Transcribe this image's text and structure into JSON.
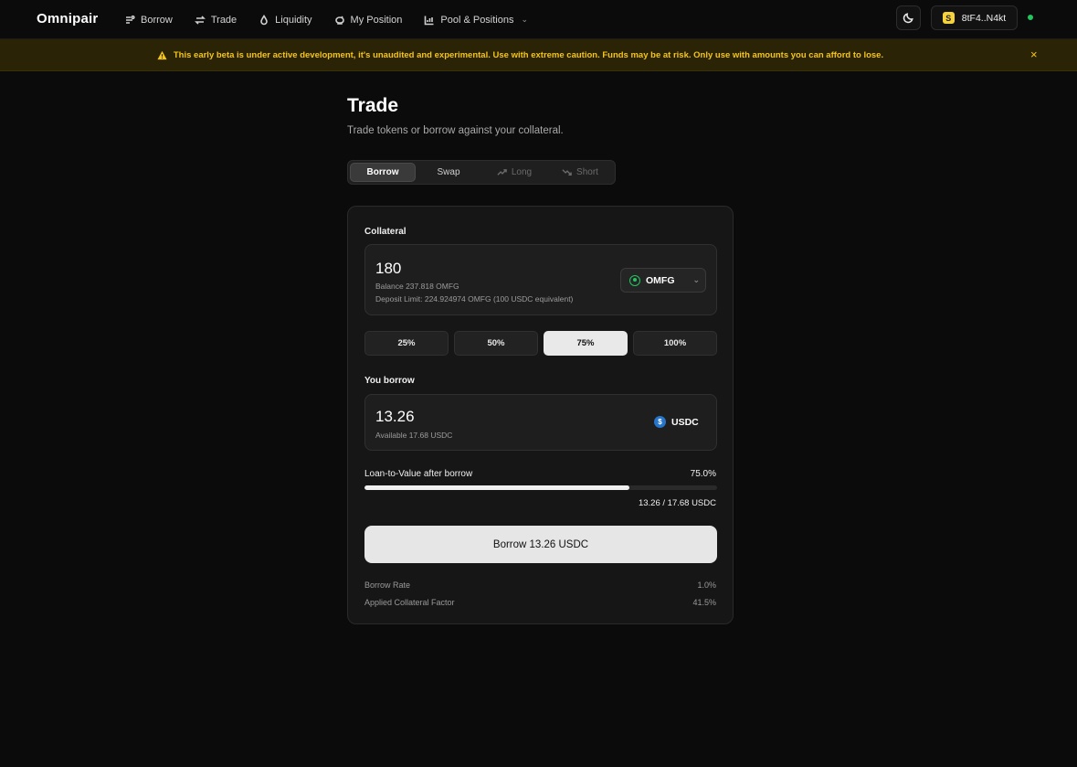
{
  "app": {
    "brand": "Omnipair"
  },
  "nav": {
    "items": [
      {
        "label": "Borrow",
        "icon": "borrow-icon"
      },
      {
        "label": "Trade",
        "icon": "swap-arrows-icon"
      },
      {
        "label": "Liquidity",
        "icon": "droplet-icon"
      },
      {
        "label": "My Position",
        "icon": "piggy-bank-icon"
      },
      {
        "label": "Pool & Positions",
        "icon": "bar-chart-icon"
      }
    ]
  },
  "header_right": {
    "theme_icon": "moon-icon",
    "wallet_label": "8tF4..N4kt",
    "wallet_logo_letter": "S",
    "status_color": "#22c55e"
  },
  "banner": {
    "text": "This early beta is under active development, it's unaudited and experimental. Use with extreme caution. Funds may be at risk. Only use with amounts you can afford to lose.",
    "close": "×",
    "color": "#f5c518"
  },
  "page": {
    "title": "Trade",
    "subtitle": "Trade tokens or borrow against your collateral."
  },
  "tabs": [
    {
      "label": "Borrow",
      "state": "active"
    },
    {
      "label": "Swap",
      "state": "normal"
    },
    {
      "label": "Long",
      "state": "disabled",
      "icon": "trend-up-icon"
    },
    {
      "label": "Short",
      "state": "disabled",
      "icon": "trend-down-icon"
    }
  ],
  "collateral": {
    "label": "Collateral",
    "amount": "180",
    "balance": "Balance 237.818 OMFG",
    "deposit_limit": "Deposit Limit: 224.924974 OMFG (100 USDC equivalent)",
    "token": "OMFG"
  },
  "percent_buttons": [
    {
      "label": "25%",
      "active": false
    },
    {
      "label": "50%",
      "active": false
    },
    {
      "label": "75%",
      "active": true
    },
    {
      "label": "100%",
      "active": false
    }
  ],
  "borrow": {
    "label": "You borrow",
    "amount": "13.26",
    "available": "Available 17.68 USDC",
    "token": "USDC",
    "token_icon_letter": "$"
  },
  "ltv": {
    "label": "Loan-to-Value after borrow",
    "value_text": "75.0%",
    "fraction": 0.75,
    "ratio_text": "13.26 / 17.68 USDC"
  },
  "action": {
    "button_label": "Borrow 13.26 USDC"
  },
  "info": [
    {
      "label": "Borrow Rate",
      "value": "1.0%"
    },
    {
      "label": "Applied Collateral Factor",
      "value": "41.5%"
    }
  ]
}
